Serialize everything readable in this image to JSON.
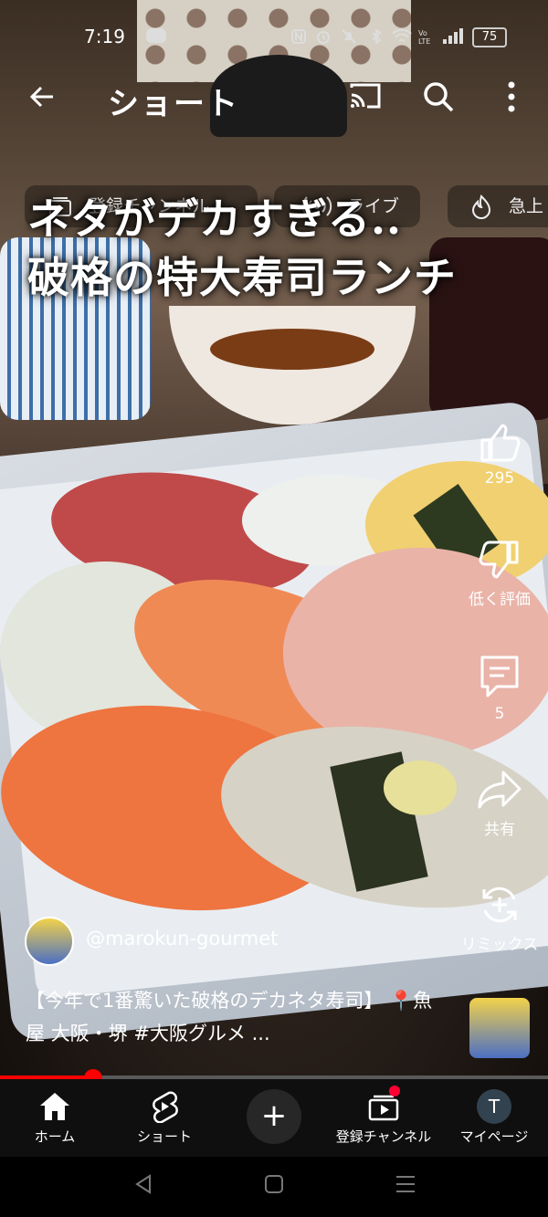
{
  "status_bar": {
    "time": "7:19",
    "battery": "75"
  },
  "top_bar": {
    "back_icon": "arrow-left",
    "title": "ショート"
  },
  "chips": [
    {
      "label": "登録チャンネル",
      "icon": "subscriptions-icon"
    },
    {
      "label": "ライブ",
      "icon": "live-icon"
    },
    {
      "label": "急上",
      "icon": "trending-icon"
    }
  ],
  "video": {
    "caption_line1": "ネタがデカすぎる..",
    "caption_line2": "破格の特大寿司ランチ",
    "progress": 0.17
  },
  "actions": {
    "like_count": "295",
    "dislike_label": "低く評価",
    "comment_count": "5",
    "share_label": "共有",
    "remix_label": "リミックス"
  },
  "channel": {
    "handle": "@marokun-gourmet",
    "description": "【今年で1番驚いた破格のデカネタ寿司】 📍魚屋 大阪・堺 #大阪グルメ ..."
  },
  "nav": {
    "home": "ホーム",
    "shorts": "ショート",
    "create": "+",
    "subscriptions": "登録チャンネル",
    "me": "マイページ",
    "me_initial": "T"
  },
  "colors": {
    "accent": "#ff0000",
    "nav_bg": "#0f0f0f"
  }
}
